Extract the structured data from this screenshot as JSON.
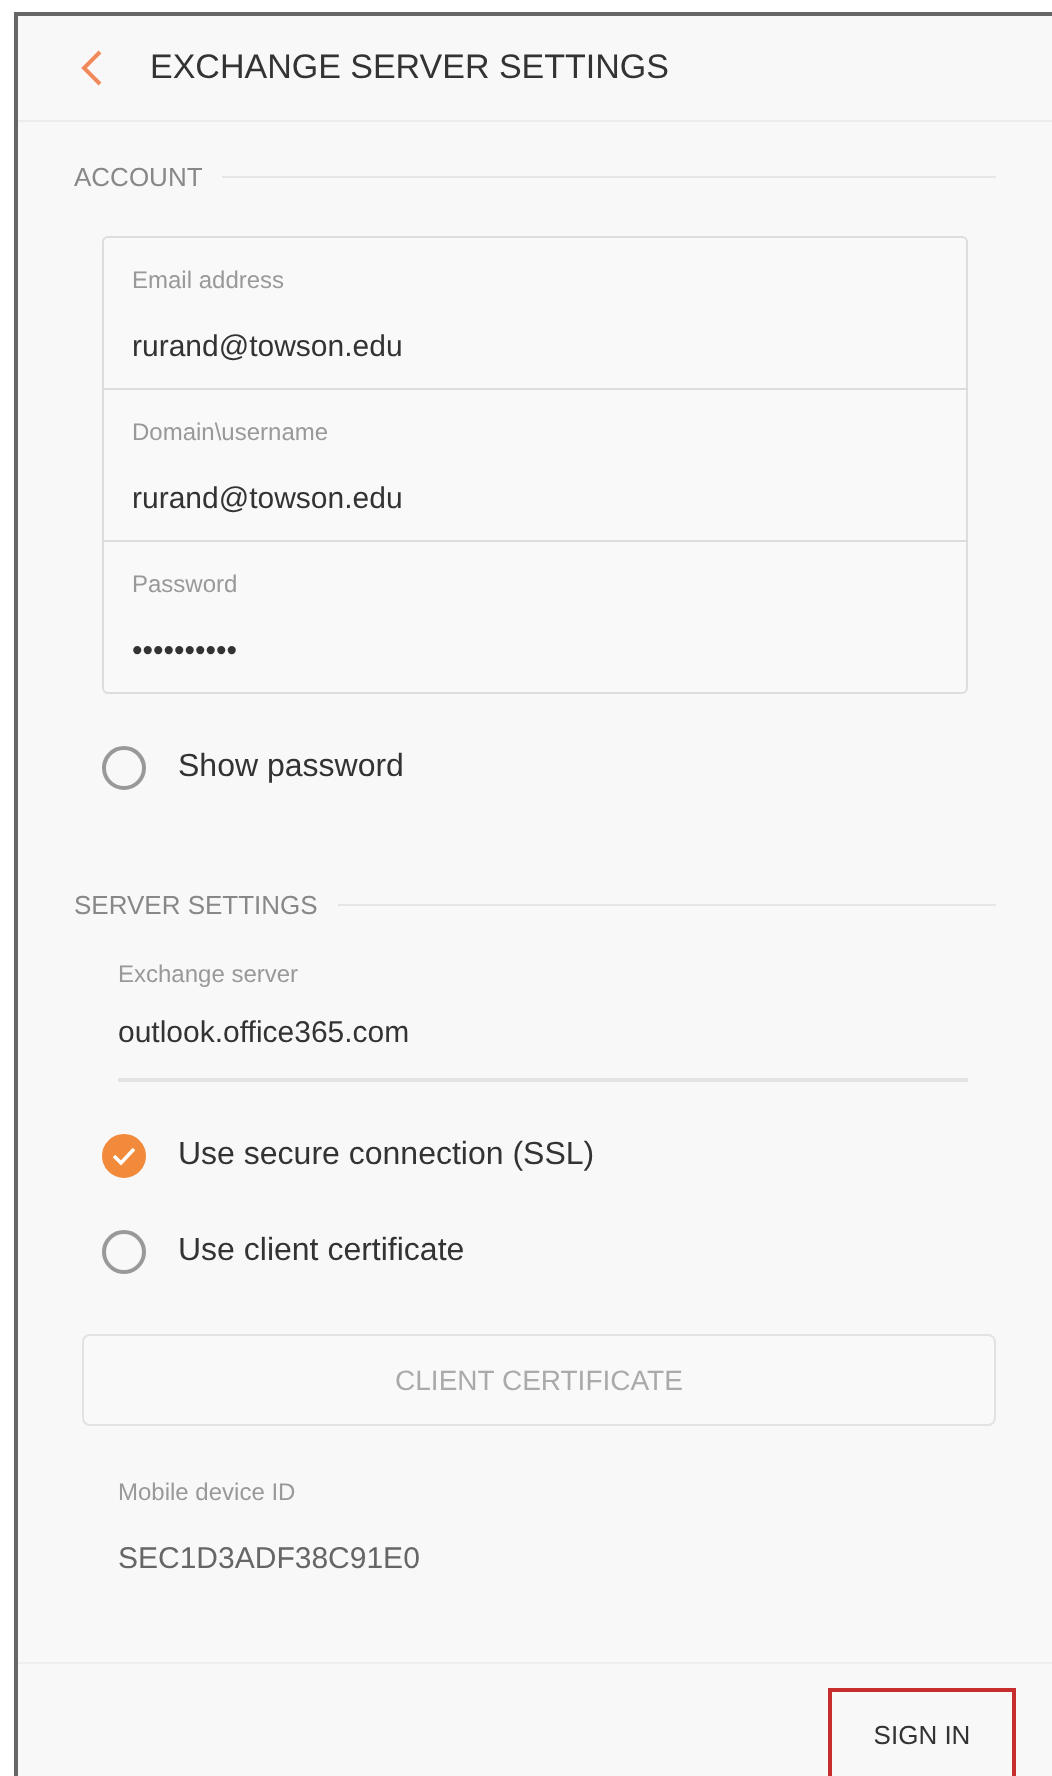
{
  "header": {
    "title": "EXCHANGE SERVER SETTINGS"
  },
  "account": {
    "heading": "ACCOUNT",
    "fields": [
      {
        "label": "Email address",
        "value": "rurand@towson.edu"
      },
      {
        "label": "Domain\\username",
        "value": "rurand@towson.edu"
      },
      {
        "label": "Password",
        "value": "••••••••••"
      }
    ],
    "options": [
      {
        "label": "Show password",
        "checked": false
      }
    ]
  },
  "server": {
    "heading": "SERVER SETTINGS",
    "field": {
      "label": "Exchange server",
      "value": "outlook.office365.com"
    },
    "options": [
      {
        "label": "Use secure connection (SSL)",
        "checked": true
      },
      {
        "label": "Use client certificate",
        "checked": false
      }
    ],
    "certificate_button": {
      "label": "CLIENT CERTIFICATE",
      "disabled": true
    },
    "device_id": {
      "label": "Mobile device ID",
      "value": "SEC1D3ADF38C91E0"
    }
  },
  "footer": {
    "button": "SIGN IN",
    "highlighted": true
  }
}
